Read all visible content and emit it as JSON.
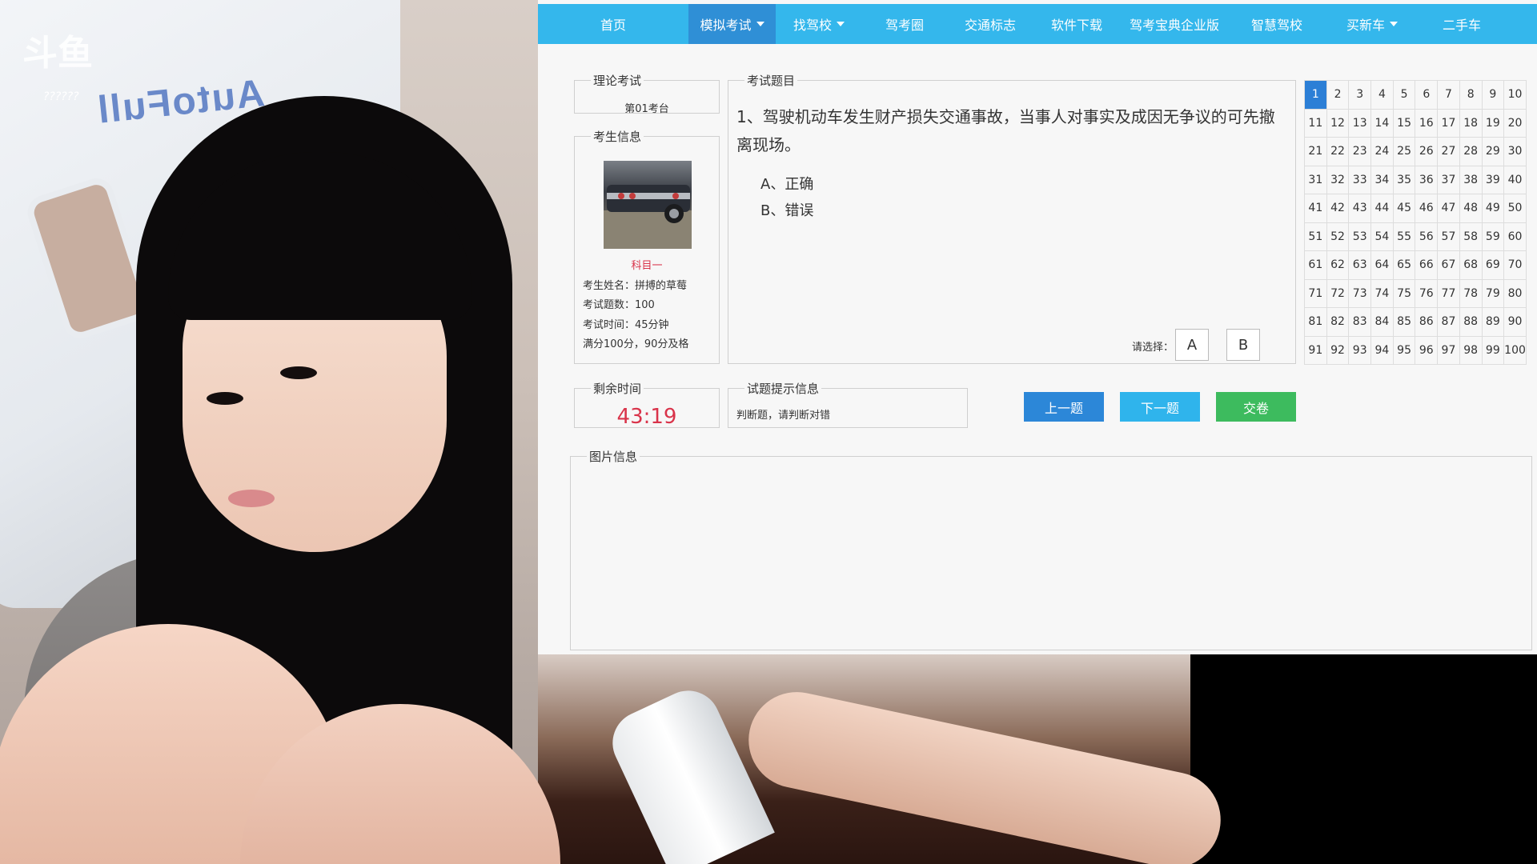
{
  "stream": {
    "watermark_logo": "斗鱼",
    "watermark_sub": "??????",
    "chair_brand": "AutoFull"
  },
  "nav": {
    "items": [
      {
        "label": "首页",
        "active": false,
        "dropdown": false
      },
      {
        "label": "模拟考试",
        "active": true,
        "dropdown": true
      },
      {
        "label": "找驾校",
        "active": false,
        "dropdown": true
      },
      {
        "label": "驾考圈",
        "active": false,
        "dropdown": false
      },
      {
        "label": "交通标志",
        "active": false,
        "dropdown": false
      },
      {
        "label": "软件下载",
        "active": false,
        "dropdown": false
      },
      {
        "label": "驾考宝典企业版",
        "active": false,
        "dropdown": false
      },
      {
        "label": "智慧驾校",
        "active": false,
        "dropdown": false
      },
      {
        "label": "买新车",
        "active": false,
        "dropdown": true
      },
      {
        "label": "二手车",
        "active": false,
        "dropdown": false
      }
    ]
  },
  "exam": {
    "theory_legend": "理论考试",
    "station": "第01考台",
    "candidate_legend": "考生信息",
    "subject": "科目一",
    "name_line": "考生姓名：拼搏的草莓",
    "count_line": "考试题数：100",
    "time_line": "考试时间：45分钟",
    "score_line": "满分100分，90分及格",
    "remaining_legend": "剩余时间",
    "remaining_time": "43:19"
  },
  "question": {
    "legend": "考试题目",
    "text": "1、驾驶机动车发生财产损失交通事故，当事人对事实及成因无争议的可先撤离现场。",
    "options": [
      "A、正确",
      "B、错误"
    ],
    "choose_label": "请选择：",
    "answer_buttons": [
      "A",
      "B"
    ]
  },
  "hint": {
    "legend": "试题提示信息",
    "text": "判断题，请判断对错"
  },
  "actions": {
    "prev": "上一题",
    "next": "下一题",
    "submit": "交卷"
  },
  "image_panel": {
    "legend": "图片信息"
  },
  "question_grid": {
    "total": 100,
    "current": 1
  },
  "colors": {
    "nav_bg": "#34b7ec",
    "nav_active": "#2f8fd6",
    "timer_red": "#d9334a",
    "subject_red": "#d9334a",
    "prev_btn": "#2c87d8",
    "next_btn": "#2fb4ec",
    "submit_btn": "#3dbb5e"
  }
}
